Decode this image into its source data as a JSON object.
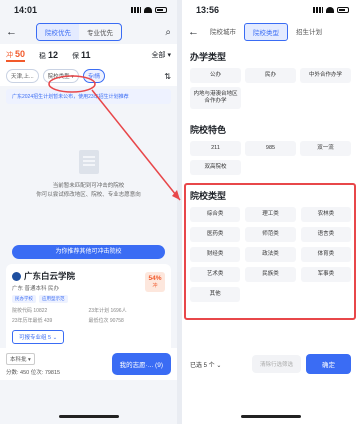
{
  "left": {
    "status": {
      "time": "14:01"
    },
    "nav": {
      "tabs": [
        "院校优先",
        "专业优先"
      ],
      "active_tab": 0
    },
    "filters": [
      {
        "label": "冲",
        "count": "50"
      },
      {
        "label": "稳",
        "count": "12"
      },
      {
        "label": "保",
        "count": "11"
      }
    ],
    "filter_all": "全部 ▾",
    "dropdowns": [
      "天津,上...",
      "院校类型 ▾",
      "专l情"
    ],
    "notice": "广东2024招生计划暂未公布，使用23年招生计划推荐",
    "empty": {
      "line1": "当前暂未匹配到可冲击的院校",
      "line2": "你可以尝试修改地区、院校、专业志愿意向"
    },
    "recommend_btn": "为你推荐其他可冲击院校",
    "card": {
      "name": "广东白云学院",
      "sub": "广东 普通本科 民办",
      "badges": [
        "民办学校",
        "应用型示范"
      ],
      "stats": [
        "院校代码 10822",
        "23年计划 1696人",
        "23年历年最低 439",
        "最低位次 90758"
      ],
      "pct": "54%",
      "pct_label": "冲",
      "major_btn": "可报专业组 5  ⌄"
    },
    "bottom": {
      "level": "本科批 ▾",
      "score": "分数: 450   位次: 79815",
      "my_volunteer": "我的志愿·... (9)"
    }
  },
  "right": {
    "status": {
      "time": "13:56"
    },
    "nav": {
      "tabs": [
        "院校城市",
        "院校类型",
        "招生计划"
      ],
      "active_tab": 1
    },
    "sections": [
      {
        "title": "办学类型",
        "items": [
          "公办",
          "民办",
          "中外合作办学",
          "内地与港澳台地区合作办学"
        ]
      },
      {
        "title": "院校特色",
        "items": [
          "211",
          "985",
          "双一流",
          "双高院校"
        ]
      },
      {
        "title": "院校类型",
        "items": [
          "综合类",
          "理工类",
          "农林类",
          "医药类",
          "师范类",
          "语言类",
          "财经类",
          "政法类",
          "体育类",
          "艺术类",
          "民族类",
          "军事类",
          "其他"
        ]
      }
    ],
    "selected": "已选 5 个 ⌄",
    "clear": "清除行选筛选",
    "confirm": "确定"
  },
  "colors": {
    "accent": "#3a6cf4",
    "chong": "#f25a2b",
    "highlight": "#e8474a"
  }
}
